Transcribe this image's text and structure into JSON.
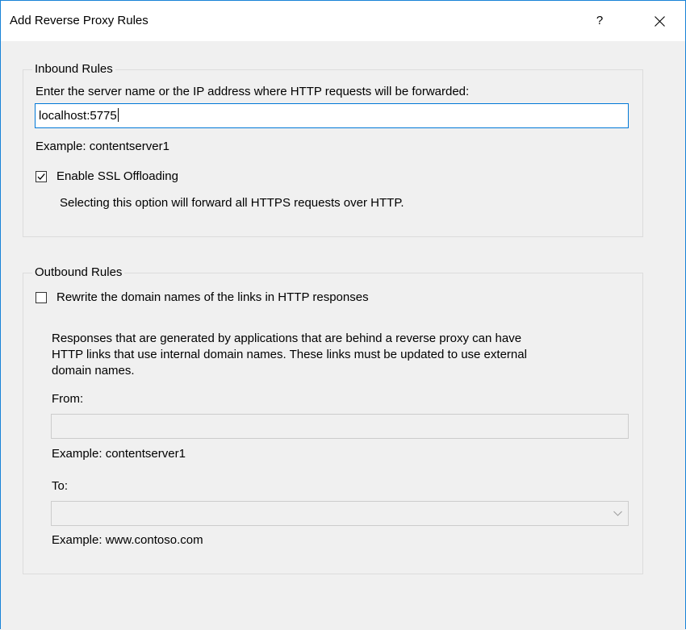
{
  "window": {
    "title": "Add Reverse Proxy Rules",
    "help_label": "?"
  },
  "inbound": {
    "legend": "Inbound Rules",
    "prompt": "Enter the server name or the IP address where HTTP requests will be forwarded:",
    "server_value": "localhost:5775",
    "example": "Example: contentserver1",
    "ssl_label": "Enable SSL Offloading",
    "ssl_checked": true,
    "ssl_description": "Selecting this option will forward all HTTPS requests over HTTP."
  },
  "outbound": {
    "legend": "Outbound Rules",
    "rewrite_label": "Rewrite the domain names of the links in HTTP responses",
    "rewrite_checked": false,
    "description_lines": [
      "Responses that are generated by applications that are behind a reverse proxy can have",
      "HTTP links that use internal domain names. These links must be updated to use external",
      "domain names."
    ],
    "from_label": "From:",
    "from_value": "",
    "from_example": "Example: contentserver1",
    "to_label": "To:",
    "to_value": "",
    "to_example": "Example: www.contoso.com"
  },
  "colors": {
    "accent": "#0078d7",
    "window_border": "#1883d7",
    "dialog_bg": "#f0f0f0",
    "group_border": "#dcdcdc"
  },
  "icons": {
    "close": "close-icon",
    "check": "checkmark-icon",
    "dropdown": "chevron-down-icon"
  }
}
